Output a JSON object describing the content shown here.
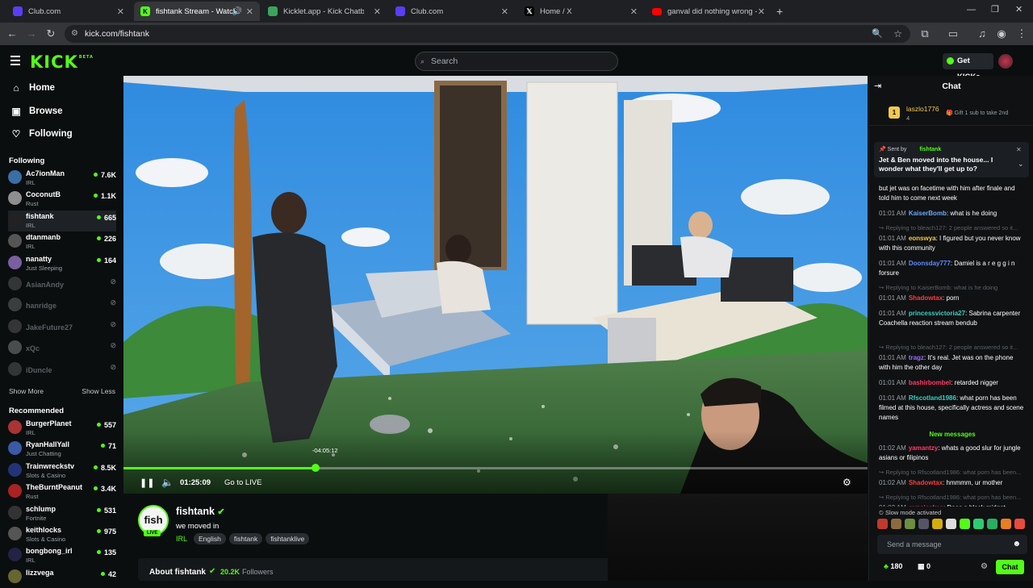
{
  "browser": {
    "tabs": [
      {
        "title": "Club.com",
        "fav_color": "#5b3df5"
      },
      {
        "title": "fishtank Stream - Watch Live",
        "fav_color": "#53fc18"
      },
      {
        "title": "Kicklet.app - Kick Chatbot and",
        "fav_color": "#3ba55d"
      },
      {
        "title": "Club.com",
        "fav_color": "#5b3df5"
      },
      {
        "title": "Home / X",
        "fav_color": "#000000"
      },
      {
        "title": "ganval did nothing wrong - You",
        "fav_color": "#ff0000"
      }
    ],
    "url": "kick.com/fishtank"
  },
  "header": {
    "logo": "KICK",
    "logo_beta": "BETA",
    "search_placeholder": "Search",
    "get_kicks": "Get KICKs"
  },
  "sidebar": {
    "nav": [
      {
        "label": "Home",
        "icon": "home-icon"
      },
      {
        "label": "Browse",
        "icon": "browse-icon"
      },
      {
        "label": "Following",
        "icon": "heart-icon"
      }
    ],
    "following_title": "Following",
    "following": [
      {
        "name": "Ac7ionMan",
        "category": "IRL",
        "viewers": "7.6K",
        "live": true
      },
      {
        "name": "CoconutB",
        "category": "Rust",
        "viewers": "1.1K",
        "live": true
      },
      {
        "name": "fishtank",
        "category": "IRL",
        "viewers": "665",
        "live": true
      },
      {
        "name": "dtanmanb",
        "category": "IRL",
        "viewers": "226",
        "live": true
      },
      {
        "name": "nanatty",
        "category": "Just Sleeping",
        "viewers": "164",
        "live": true
      },
      {
        "name": "AsianAndy",
        "category": "",
        "viewers": "",
        "live": false
      },
      {
        "name": "hanridge",
        "category": "",
        "viewers": "",
        "live": false
      },
      {
        "name": "JakeFuture27",
        "category": "",
        "viewers": "",
        "live": false
      },
      {
        "name": "xQc",
        "category": "",
        "viewers": "",
        "live": false
      },
      {
        "name": "iDuncle",
        "category": "",
        "viewers": "",
        "live": false
      }
    ],
    "show_more": "Show More",
    "show_less": "Show Less",
    "recommended_title": "Recommended",
    "recommended": [
      {
        "name": "BurgerPlanet",
        "category": "IRL",
        "viewers": "557"
      },
      {
        "name": "RyanHallYall",
        "category": "Just Chatting",
        "viewers": "71"
      },
      {
        "name": "Trainwreckstv",
        "category": "Slots & Casino",
        "viewers": "8.5K"
      },
      {
        "name": "TheBurntPeanut",
        "category": "Rust",
        "viewers": "3.4K"
      },
      {
        "name": "schlump",
        "category": "Fortnite",
        "viewers": "531"
      },
      {
        "name": "keithlocks",
        "category": "Slots & Casino",
        "viewers": "975"
      },
      {
        "name": "bongbong_irl",
        "category": "IRL",
        "viewers": "135"
      },
      {
        "name": "lizzvega",
        "category": "",
        "viewers": "42"
      }
    ]
  },
  "player": {
    "elapsed": "01:25:09",
    "hover_time": "-04:05:12",
    "go_live": "Go to LIVE",
    "progress_fraction": 0.258
  },
  "stream": {
    "channel": "fishtank",
    "avatar_text": "fish",
    "live_badge": "LIVE",
    "title": "we moved in",
    "category": "IRL",
    "tags": [
      "English",
      "fishtank",
      "fishtanklive"
    ],
    "about_title": "About fishtank",
    "followers": "20.2K",
    "followers_label": "Followers"
  },
  "chat": {
    "title": "Chat",
    "top_gifter": {
      "name": "laszlo1776",
      "count": "4",
      "rank": "1",
      "cta": "Gift 1 sub to take 2nd"
    },
    "pinned": {
      "sent_by": "Sent by",
      "sender": "fishtank",
      "text": "Jet & Ben moved into the house... I wonder what they'll get up to?"
    },
    "messages": [
      {
        "kind": "text",
        "text": "but jet was on facetime with him after finale and told him to come next week"
      },
      {
        "kind": "msg",
        "time": "01:01 AM",
        "user": "KaiserBomb",
        "color": "#6aa9ff",
        "text": "what is he doing"
      },
      {
        "kind": "reply",
        "text": "Replying to bleach127: 2 people answered so it..."
      },
      {
        "kind": "msg",
        "time": "01:01 AM",
        "user": "eonswya",
        "color": "#f2c94c",
        "text": "I figured but you never know with this community"
      },
      {
        "kind": "msg",
        "time": "01:01 AM",
        "user": "Doonsday777",
        "color": "#5b8cff",
        "text": "Damiel is a r e g g i n forsure"
      },
      {
        "kind": "reply",
        "text": "Replying to KaiserBomb: what is he doing"
      },
      {
        "kind": "msg",
        "time": "01:01 AM",
        "user": "Shadowtax",
        "color": "#ff3b3b",
        "text": "porn"
      },
      {
        "kind": "msg",
        "time": "01:01 AM",
        "user": "princessvictoria27",
        "color": "#36d1c4",
        "text": "Sabrina carpenter Coachella reaction stream bendub"
      },
      {
        "kind": "reply",
        "text": "Replying to bleach127: 2 people answered so it..."
      },
      {
        "kind": "msg",
        "time": "01:01 AM",
        "user": "tragz",
        "color": "#9b6bff",
        "text": "It's real. Jet was on the phone with him the other day"
      },
      {
        "kind": "msg",
        "time": "01:01 AM",
        "user": "bashirbombel",
        "color": "#ff3b6b",
        "text": "retarded nigger"
      },
      {
        "kind": "msg",
        "time": "01:01 AM",
        "user": "Rfscotland1986",
        "color": "#36d1c4",
        "text": "what porn has been filmed at this house, specifically actress and scene names"
      },
      {
        "kind": "divider",
        "text": "New messages"
      },
      {
        "kind": "msg",
        "time": "01:02 AM",
        "user": "yamantzy",
        "color": "#ff3b6b",
        "text": "whats a good slur for jungle asians or filipinos"
      },
      {
        "kind": "reply",
        "text": "Replying to Rfscotland1986: what porn has been..."
      },
      {
        "kind": "msg",
        "time": "01:02 AM",
        "user": "Shadowtax",
        "color": "#ff3b3b",
        "text": "hmmmm, ur mother"
      },
      {
        "kind": "reply",
        "text": "Replying to Rfscotland1986: what porn has been..."
      },
      {
        "kind": "msg",
        "time": "01:02 AM",
        "user": "cupsicakes",
        "color": "#ff3b6b",
        "text": "Does a black midget twerking on landon count as soft core?"
      }
    ],
    "slow_mode": "Slow mode activated",
    "input_placeholder": "Send a message",
    "kicks_count": "180",
    "gifts_count": "0",
    "send_label": "Chat"
  }
}
